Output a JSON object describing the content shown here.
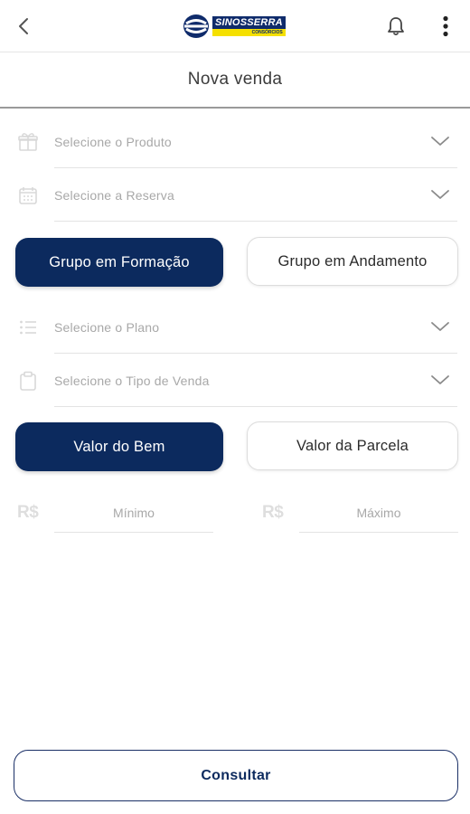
{
  "header": {
    "back_icon": "chevron-left-icon",
    "logo": {
      "name": "SINOSSERRA",
      "sub": "CONSÓRCIOS",
      "colors": {
        "blue": "#0f2b6b",
        "yellow": "#f5e000"
      }
    },
    "bell_icon": "bell-icon",
    "menu_icon": "more-vertical-icon"
  },
  "page": {
    "title": "Nova venda"
  },
  "selects": {
    "produto": {
      "placeholder": "Selecione o Produto",
      "icon": "gift-icon"
    },
    "reserva": {
      "placeholder": "Selecione a Reserva",
      "icon": "calendar-icon"
    },
    "plano": {
      "placeholder": "Selecione o Plano",
      "icon": "list-icon"
    },
    "tipo_venda": {
      "placeholder": "Selecione o Tipo de Venda",
      "icon": "clipboard-icon"
    }
  },
  "grupo_toggle": {
    "formacao": "Grupo em Formação",
    "andamento": "Grupo em Andamento",
    "selected": "formacao"
  },
  "valor_toggle": {
    "bem": "Valor do Bem",
    "parcela": "Valor da Parcela",
    "selected": "bem"
  },
  "range": {
    "currency": "R$",
    "min_placeholder": "Mínimo",
    "max_placeholder": "Máximo"
  },
  "actions": {
    "consultar": "Consultar"
  },
  "colors": {
    "primary": "#0c2a5e",
    "placeholder": "#a8a8a8",
    "divider": "#e3e3e3"
  }
}
